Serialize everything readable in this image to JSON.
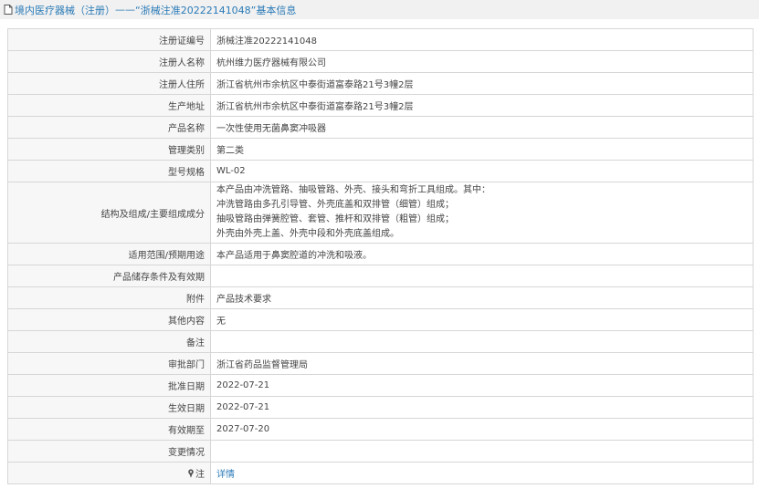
{
  "header": {
    "icon": "document-icon",
    "breadcrumb": "境内医疗器械（注册）",
    "separator": " —— ",
    "title": "“浙械注准20222141048”基本信息"
  },
  "rows": [
    {
      "label": "注册证编号",
      "value": "浙械注准20222141048"
    },
    {
      "label": "注册人名称",
      "value": "杭州维力医疗器械有限公司"
    },
    {
      "label": "注册人住所",
      "value": "浙江省杭州市余杭区中泰街道富泰路21号3幢2层"
    },
    {
      "label": "生产地址",
      "value": "浙江省杭州市余杭区中泰街道富泰路21号3幢2层"
    },
    {
      "label": "产品名称",
      "value": "一次性使用无菌鼻窦冲吸器"
    },
    {
      "label": "管理类别",
      "value": "第二类"
    },
    {
      "label": "型号规格",
      "value": "WL-02"
    }
  ],
  "structure": {
    "label": "结构及组成/主要组成成分",
    "lines": [
      "本产品由冲洗管路、抽吸管路、外壳、接头和弯折工具组成。其中：",
      "冲洗管路由多孔引导管、外壳底盖和双排管（细管）组成；",
      "抽吸管路由弹簧腔管、套管、推杆和双排管（粗管）组成；",
      "外壳由外壳上盖、外壳中段和外壳底盖组成。"
    ]
  },
  "rows2": [
    {
      "label": "适用范围/预期用途",
      "value": "本产品适用于鼻窦腔道的冲洗和吸液。"
    },
    {
      "label": "产品储存条件及有效期",
      "value": ""
    },
    {
      "label": "附件",
      "value": "产品技术要求"
    },
    {
      "label": "其他内容",
      "value": "无"
    },
    {
      "label": "备注",
      "value": ""
    },
    {
      "label": "审批部门",
      "value": "浙江省药品监督管理局"
    },
    {
      "label": "批准日期",
      "value": "2022-07-21"
    },
    {
      "label": "生效日期",
      "value": "2022-07-21"
    },
    {
      "label": "有效期至",
      "value": "2027-07-20"
    },
    {
      "label": "变更情况",
      "value": ""
    }
  ],
  "note": {
    "icon": "pin-icon",
    "label": "注",
    "link": "详情"
  }
}
